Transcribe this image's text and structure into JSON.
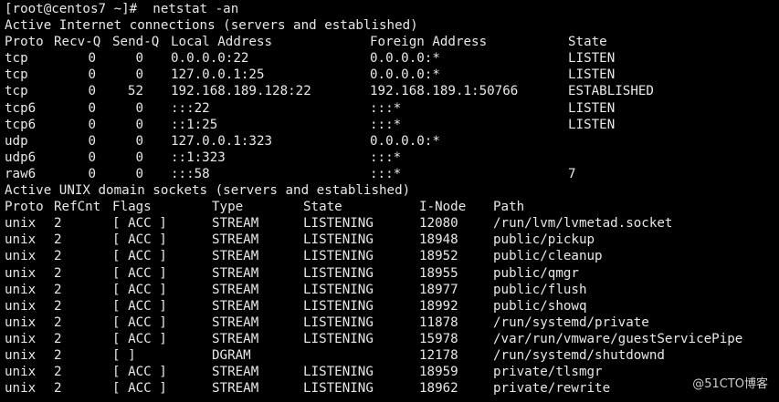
{
  "prompt": "[root@centos7 ~]#  netstat -an",
  "inet": {
    "title": "Active Internet connections (servers and established)",
    "headers": [
      "Proto",
      "Recv-Q",
      "Send-Q",
      "Local Address",
      "Foreign Address",
      "State"
    ],
    "rows": [
      [
        "tcp",
        "0",
        "0",
        "0.0.0.0:22",
        "0.0.0.0:*",
        "LISTEN"
      ],
      [
        "tcp",
        "0",
        "0",
        "127.0.0.1:25",
        "0.0.0.0:*",
        "LISTEN"
      ],
      [
        "tcp",
        "0",
        "52",
        "192.168.189.128:22",
        "192.168.189.1:50766",
        "ESTABLISHED"
      ],
      [
        "tcp6",
        "0",
        "0",
        ":::22",
        ":::*",
        "LISTEN"
      ],
      [
        "tcp6",
        "0",
        "0",
        "::1:25",
        ":::*",
        "LISTEN"
      ],
      [
        "udp",
        "0",
        "0",
        "127.0.0.1:323",
        "0.0.0.0:*",
        ""
      ],
      [
        "udp6",
        "0",
        "0",
        "::1:323",
        ":::*",
        ""
      ],
      [
        "raw6",
        "0",
        "0",
        ":::58",
        ":::*",
        "7"
      ]
    ]
  },
  "unix": {
    "title": "Active UNIX domain sockets (servers and established)",
    "headers": [
      "Proto",
      "RefCnt",
      "Flags",
      "Type",
      "State",
      "I-Node",
      "Path"
    ],
    "rows": [
      [
        "unix",
        "2",
        "[ ACC ]",
        "STREAM",
        "LISTENING",
        "12080",
        "/run/lvm/lvmetad.socket"
      ],
      [
        "unix",
        "2",
        "[ ACC ]",
        "STREAM",
        "LISTENING",
        "18948",
        "public/pickup"
      ],
      [
        "unix",
        "2",
        "[ ACC ]",
        "STREAM",
        "LISTENING",
        "18952",
        "public/cleanup"
      ],
      [
        "unix",
        "2",
        "[ ACC ]",
        "STREAM",
        "LISTENING",
        "18955",
        "public/qmgr"
      ],
      [
        "unix",
        "2",
        "[ ACC ]",
        "STREAM",
        "LISTENING",
        "18977",
        "public/flush"
      ],
      [
        "unix",
        "2",
        "[ ACC ]",
        "STREAM",
        "LISTENING",
        "18992",
        "public/showq"
      ],
      [
        "unix",
        "2",
        "[ ACC ]",
        "STREAM",
        "LISTENING",
        "11878",
        "/run/systemd/private"
      ],
      [
        "unix",
        "2",
        "[ ACC ]",
        "STREAM",
        "LISTENING",
        "15978",
        "/var/run/vmware/guestServicePipe"
      ],
      [
        "unix",
        "2",
        "[ ]",
        "DGRAM",
        "",
        "12178",
        "/run/systemd/shutdownd"
      ],
      [
        "unix",
        "2",
        "[ ACC ]",
        "STREAM",
        "LISTENING",
        "18959",
        "private/tlsmgr"
      ],
      [
        "unix",
        "2",
        "[ ACC ]",
        "STREAM",
        "LISTENING",
        "18962",
        "private/rewrite"
      ]
    ]
  },
  "watermark": "@51CTO博客",
  "colors": {
    "background": "#000000",
    "text": "#e8e8e8"
  }
}
